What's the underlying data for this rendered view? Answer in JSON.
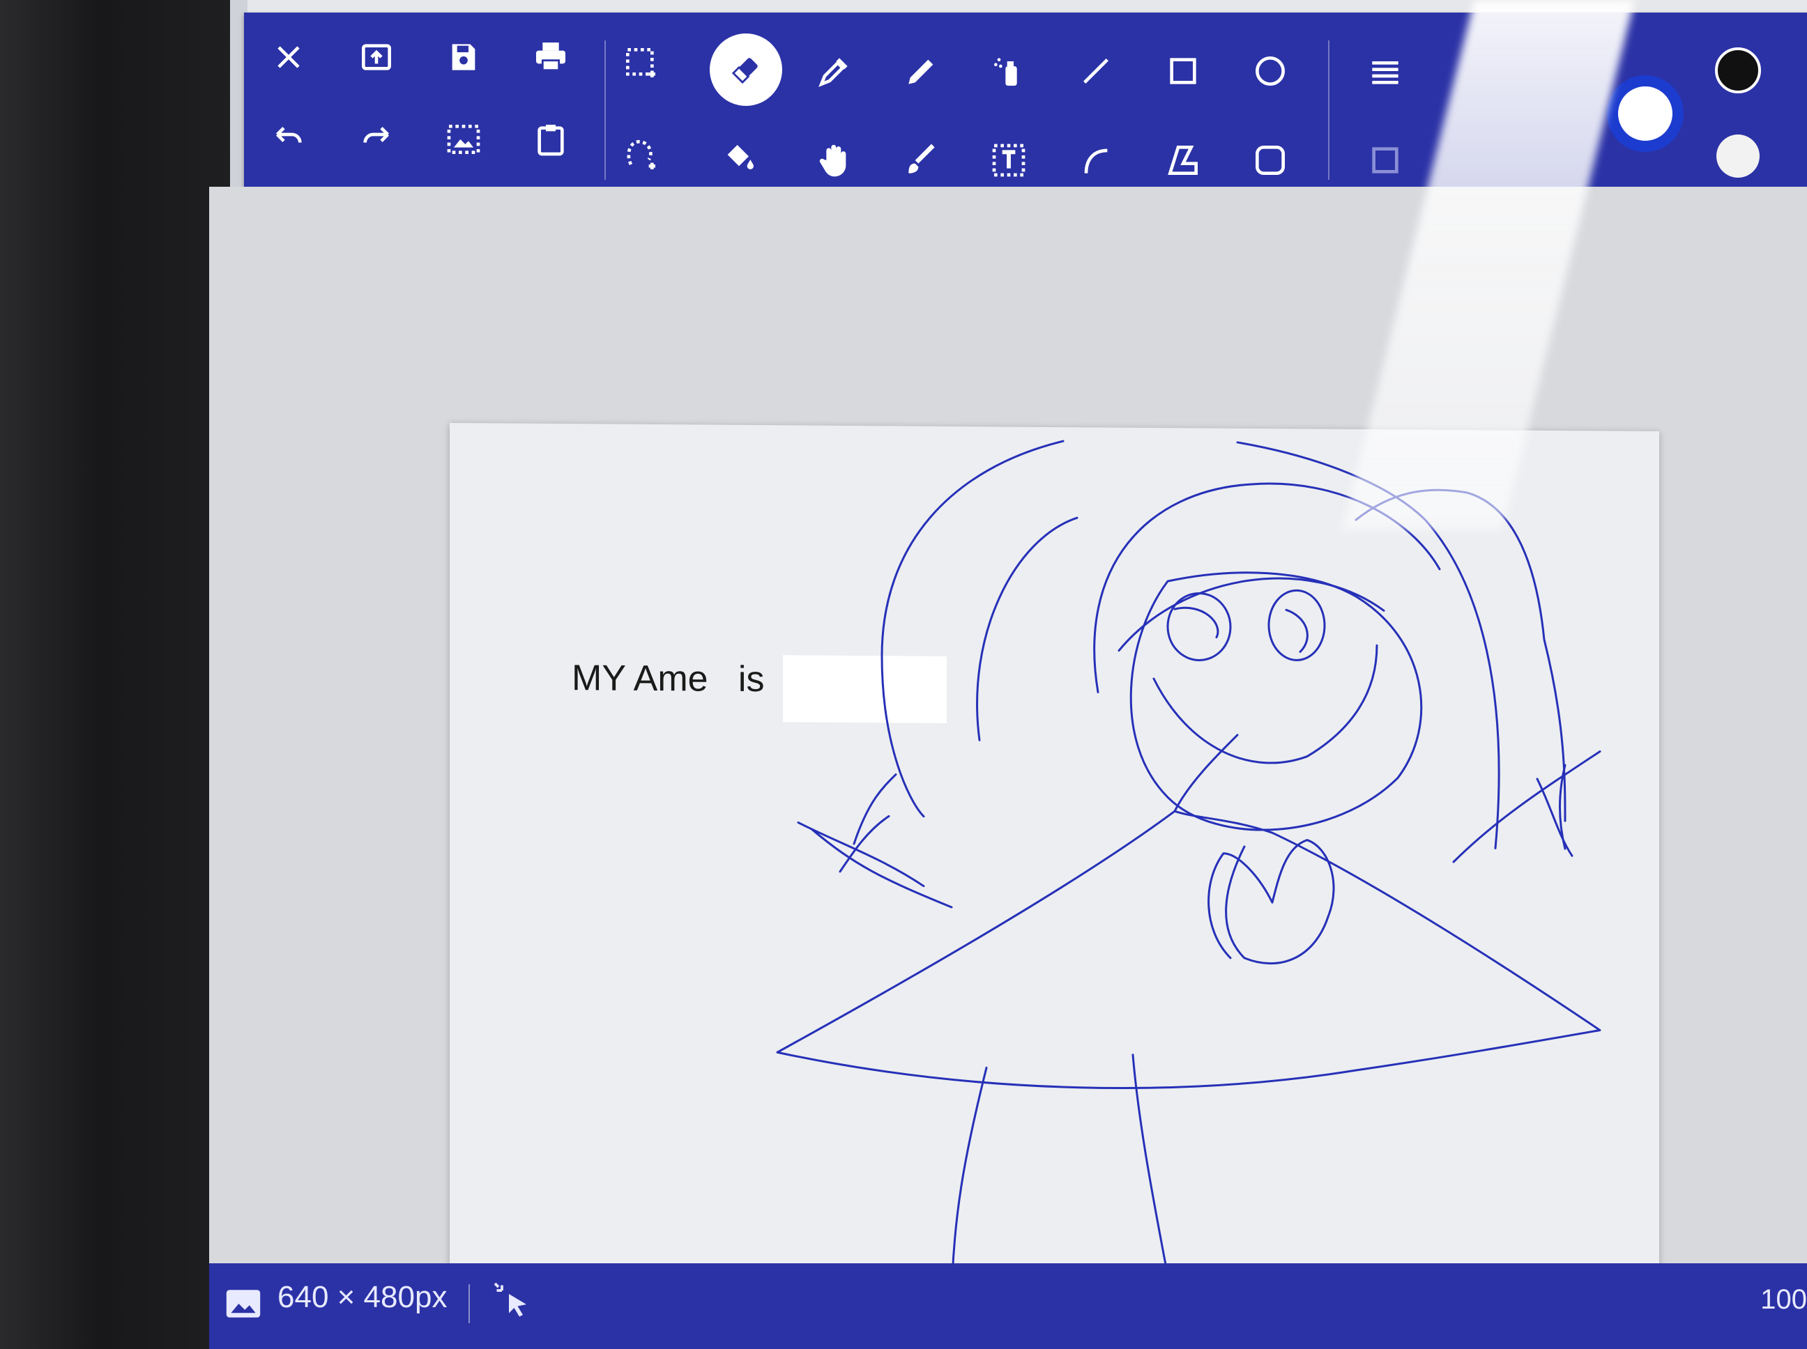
{
  "toolbar": {
    "row1": [
      {
        "name": "close-icon"
      },
      {
        "name": "open-icon"
      },
      {
        "name": "save-icon"
      },
      {
        "name": "print-icon"
      },
      {
        "name": "rect-select-icon"
      },
      {
        "name": "eraser-icon",
        "active": true
      },
      {
        "name": "color-picker-icon"
      },
      {
        "name": "pencil-icon"
      },
      {
        "name": "spray-icon"
      },
      {
        "name": "line-icon"
      },
      {
        "name": "rectangle-icon"
      },
      {
        "name": "ellipse-icon"
      }
    ],
    "row2": [
      {
        "name": "undo-icon"
      },
      {
        "name": "redo-icon"
      },
      {
        "name": "image-select-icon"
      },
      {
        "name": "paste-icon"
      },
      {
        "name": "lasso-select-icon"
      },
      {
        "name": "fill-icon"
      },
      {
        "name": "hand-icon"
      },
      {
        "name": "brush-icon"
      },
      {
        "name": "text-icon"
      },
      {
        "name": "curve-icon"
      },
      {
        "name": "polygon-icon"
      },
      {
        "name": "rounded-rect-icon"
      }
    ],
    "colors": {
      "primary": "#111111",
      "secondary": "#ffffff",
      "accent": "#2b32a6"
    }
  },
  "canvas": {
    "text_before": "MY Ame",
    "text_after": "is",
    "stroke_color": "#2630b8"
  },
  "statusbar": {
    "size": "640 × 480px",
    "zoom": "100"
  }
}
